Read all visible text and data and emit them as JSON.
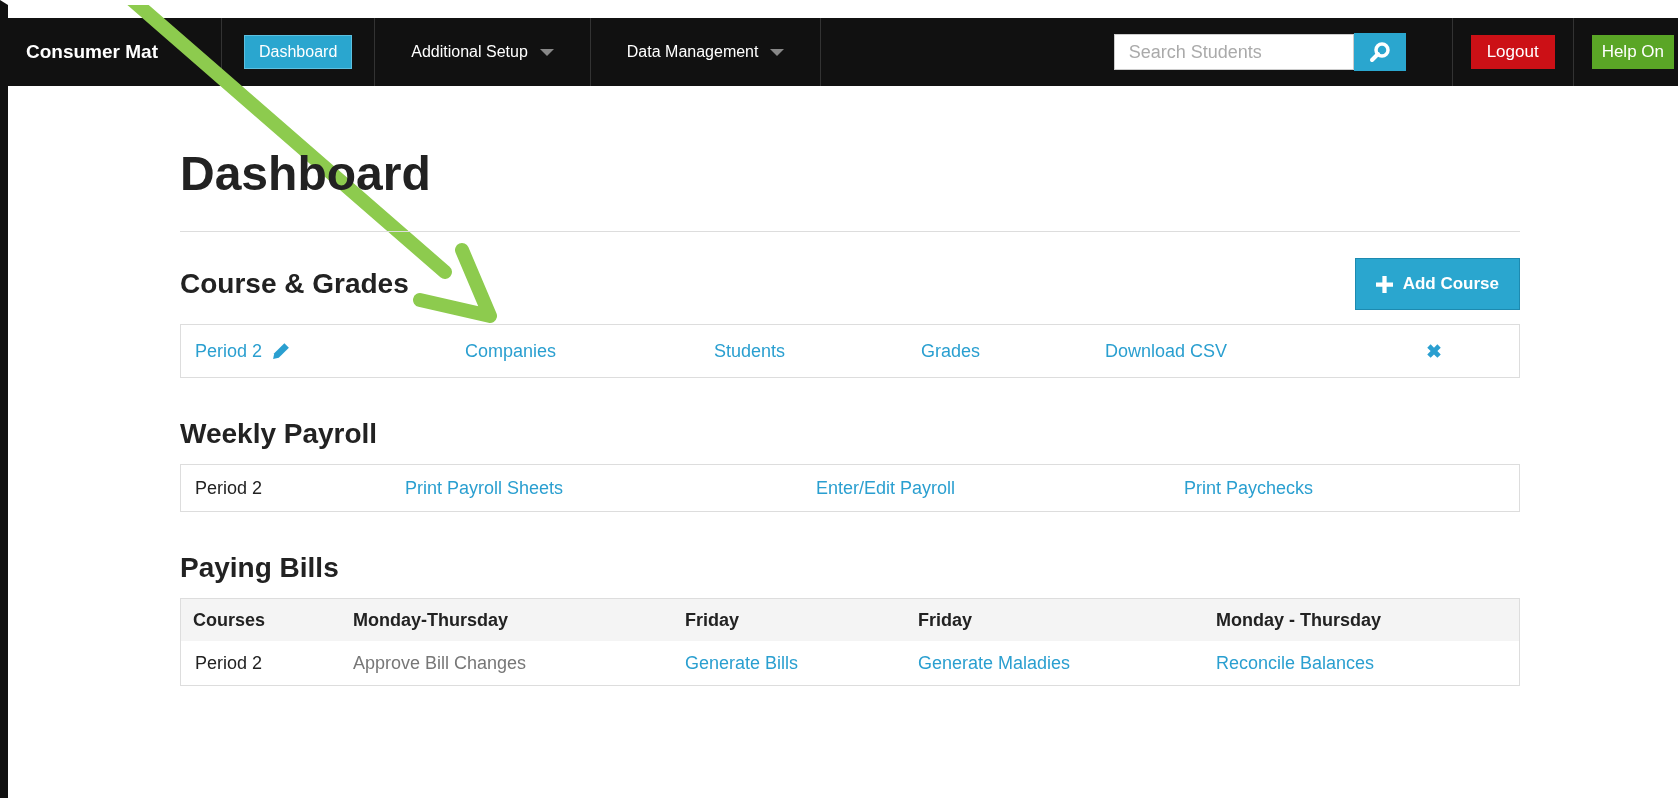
{
  "navbar": {
    "brand": "Consumer Mat",
    "items": [
      {
        "label": "Dashboard",
        "selected": true,
        "dropdown": false
      },
      {
        "label": "Additional Setup",
        "selected": false,
        "dropdown": true
      },
      {
        "label": "Data Management",
        "selected": false,
        "dropdown": true
      }
    ],
    "search": {
      "placeholder": "Search Students"
    },
    "logout": "Logout",
    "help": "Help On"
  },
  "page": {
    "title": "Dashboard"
  },
  "courses": {
    "title": "Course & Grades",
    "add_button": "Add Course",
    "rows": [
      {
        "period": "Period 2",
        "links": [
          "Companies",
          "Students",
          "Grades",
          "Download CSV"
        ]
      }
    ]
  },
  "payroll": {
    "title": "Weekly Payroll",
    "rows": [
      {
        "period": "Period 2",
        "links": [
          "Print Payroll Sheets",
          "Enter/Edit Payroll",
          "Print Paychecks"
        ]
      }
    ]
  },
  "bills": {
    "title": "Paying Bills",
    "columns": [
      "Courses",
      "Monday-Thursday",
      "Friday",
      "Friday",
      "Monday - Thursday"
    ],
    "rows": [
      {
        "cells": [
          {
            "text": "Period 2",
            "kind": "text"
          },
          {
            "text": "Approve Bill Changes",
            "kind": "disabled"
          },
          {
            "text": "Generate Bills",
            "kind": "link"
          },
          {
            "text": "Generate Maladies",
            "kind": "link"
          },
          {
            "text": "Reconcile Balances",
            "kind": "link"
          }
        ]
      }
    ]
  }
}
